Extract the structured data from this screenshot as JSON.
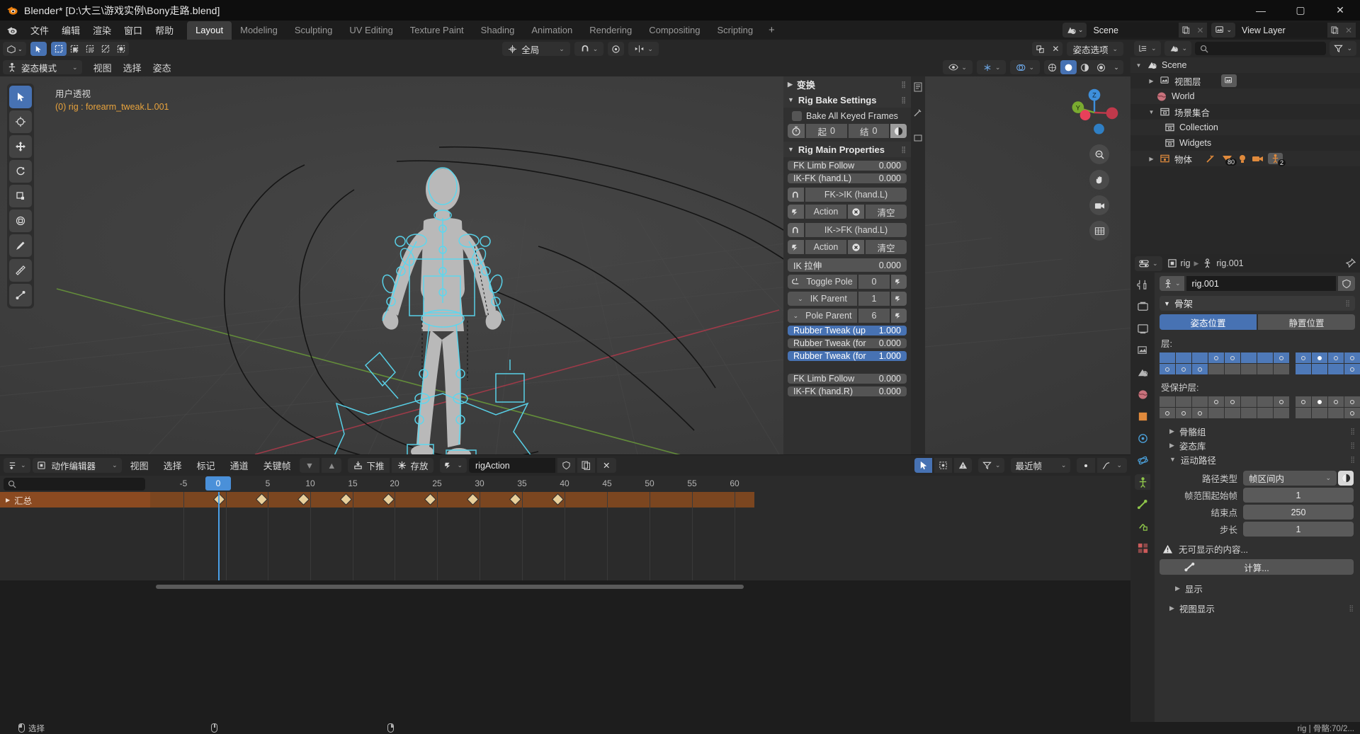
{
  "titlebar": {
    "title": "Blender* [D:\\大三\\游戏实例\\Bony走路.blend]",
    "minimize": "—",
    "maximize": "▢",
    "close": "✕"
  },
  "topbar": {
    "menus": [
      "文件",
      "编辑",
      "渲染",
      "窗口",
      "帮助"
    ],
    "workspaces": [
      "Layout",
      "Modeling",
      "Sculpting",
      "UV Editing",
      "Texture Paint",
      "Shading",
      "Animation",
      "Rendering",
      "Compositing",
      "Scripting"
    ],
    "active_workspace": "Layout",
    "add_workspace": "+",
    "scene_name": "Scene",
    "view_layer_name": "View Layer"
  },
  "viewport_header": {
    "transform_orientation": "全局",
    "select_mode_label": "姿态选项",
    "mode": "姿态模式",
    "menus": [
      "视图",
      "选择",
      "姿态"
    ]
  },
  "viewport": {
    "view_name": "用户透视",
    "active_object": "(0) rig : forearm_tweak.L.001",
    "gizmo_axes": [
      "X",
      "Y",
      "Z"
    ]
  },
  "npanel": {
    "sections": [
      {
        "title": "变换",
        "expanded": false
      },
      {
        "title": "Rig Bake Settings",
        "expanded": true
      },
      {
        "title": "Rig Main Properties",
        "expanded": true
      }
    ],
    "bake": {
      "checkbox_label": "Bake All Keyed Frames",
      "checked": false,
      "start_label": "起",
      "start_value": "0",
      "end_label": "结",
      "end_value": "0"
    },
    "props": [
      {
        "kind": "value",
        "label": "FK Limb Follow",
        "value": "0.000",
        "highlight": false
      },
      {
        "kind": "value",
        "label": "IK-FK (hand.L)",
        "value": "0.000",
        "highlight": false
      },
      {
        "kind": "op",
        "label": "FK->IK (hand.L)"
      },
      {
        "kind": "action",
        "label": "Action",
        "clear": "清空"
      },
      {
        "kind": "op",
        "label": "IK->FK (hand.L)"
      },
      {
        "kind": "action",
        "label": "Action",
        "clear": "清空"
      },
      {
        "kind": "value",
        "label": "IK 拉伸",
        "value": "0.000",
        "highlight": false
      },
      {
        "kind": "stepper",
        "label": "Toggle Pole",
        "value": "0"
      },
      {
        "kind": "dropdown",
        "label": "IK Parent",
        "value": "1"
      },
      {
        "kind": "dropdown",
        "label": "Pole Parent",
        "value": "6"
      },
      {
        "kind": "value",
        "label": "Rubber Tweak (up",
        "value": "1.000",
        "highlight": true
      },
      {
        "kind": "value",
        "label": "Rubber Tweak (for",
        "value": "0.000",
        "highlight": false
      },
      {
        "kind": "value",
        "label": "Rubber Tweak (for",
        "value": "1.000",
        "highlight": true
      },
      {
        "kind": "spacer"
      },
      {
        "kind": "value",
        "label": "FK Limb Follow",
        "value": "0.000",
        "highlight": false
      },
      {
        "kind": "value",
        "label": "IK-FK (hand.R)",
        "value": "0.000",
        "highlight": false
      }
    ]
  },
  "dopesheet": {
    "editor_name": "动作编辑器",
    "menus": [
      "视图",
      "选择",
      "标记",
      "通道",
      "关键帧"
    ],
    "push_down": "下推",
    "stash": "存放",
    "action_name": "rigAction",
    "snap_label": "最近帧",
    "search_placeholder": "",
    "channels": [
      {
        "name": "汇总",
        "expanded": false
      }
    ],
    "ruler_ticks": [
      "-5",
      "0",
      "5",
      "10",
      "15",
      "20",
      "25",
      "30",
      "35",
      "40",
      "45",
      "50",
      "55",
      "60"
    ],
    "current_frame": "0",
    "keyframes": [
      0,
      5,
      10,
      15,
      20,
      25,
      30,
      35,
      40
    ]
  },
  "outliner": {
    "display_mode": "视图层",
    "search_placeholder": "",
    "rows": [
      {
        "indent": 0,
        "tri": "▼",
        "icon": "scene-icon",
        "label": "Scene"
      },
      {
        "indent": 1,
        "tri": "▶",
        "icon": "viewlayer-icon",
        "label": "视图层",
        "extra": "viewlayer-badge"
      },
      {
        "indent": 1,
        "tri": "",
        "icon": "world-icon",
        "label": "World"
      },
      {
        "indent": 1,
        "tri": "▼",
        "icon": "collection-icon",
        "label": "场景集合"
      },
      {
        "indent": 2,
        "tri": "",
        "icon": "collection-icon",
        "label": "Collection"
      },
      {
        "indent": 2,
        "tri": "",
        "icon": "collection-icon",
        "label": "Widgets"
      },
      {
        "indent": 1,
        "tri": "▶",
        "icon": "objects-icon",
        "label": "物体",
        "counts": [
          "80",
          "2"
        ]
      }
    ]
  },
  "properties": {
    "breadcrumb": [
      "rig",
      "rig.001"
    ],
    "id_name": "rig.001",
    "sections": {
      "armature_title": "骨架",
      "pose_position": "姿态位置",
      "rest_position": "静置位置",
      "pose_active": true,
      "layers_label": "层:",
      "protected_layers_label": "受保护层:",
      "bone_groups": "骨骼组",
      "pose_library": "姿态库",
      "motion_paths": "运动路径",
      "display": "显示",
      "viewport_display": "视图显示"
    },
    "motion_paths": {
      "path_type_label": "路径类型",
      "path_type_value": "帧区间内",
      "frame_start_label": "帧范围起始帧",
      "frame_start_value": "1",
      "frame_end_label": "结束点",
      "frame_end_value": "250",
      "step_label": "步长",
      "step_value": "1",
      "warning": "无可显示的内容...",
      "calculate": "计算..."
    },
    "layers_top": [
      [
        true,
        true,
        true,
        true,
        true,
        true,
        true,
        true
      ],
      [
        true,
        true,
        true,
        false,
        false,
        false,
        false,
        false
      ]
    ],
    "layers_top_dots": [
      [
        false,
        false,
        false,
        true,
        true,
        false,
        false,
        true
      ],
      [
        true,
        true,
        true,
        false,
        false,
        false,
        false,
        false
      ]
    ],
    "layers_top2": [
      [
        true,
        true,
        true,
        true,
        true,
        true,
        true,
        true
      ],
      [
        true,
        true,
        true,
        true,
        false,
        false,
        false,
        false
      ]
    ],
    "layers_top2_dots": [
      [
        true,
        "filled",
        true,
        true,
        true,
        true,
        true,
        true
      ],
      [
        false,
        false,
        false,
        true,
        true,
        true,
        true,
        true
      ]
    ],
    "layers_prot": [
      [
        false,
        false,
        false,
        false,
        false,
        false,
        false,
        false
      ],
      [
        false,
        false,
        false,
        false,
        false,
        false,
        false,
        false
      ]
    ],
    "layers_prot_dots": [
      [
        false,
        false,
        false,
        true,
        true,
        false,
        false,
        true
      ],
      [
        true,
        true,
        true,
        false,
        false,
        false,
        false,
        false
      ]
    ],
    "layers_prot2_dots": [
      [
        true,
        "filled",
        true,
        true,
        true,
        true,
        true,
        true
      ],
      [
        false,
        false,
        false,
        true,
        true,
        true,
        true,
        true
      ]
    ]
  },
  "statusbar": {
    "select_label": "选择",
    "info": "rig | 骨骼:70/2...",
    "version": ""
  },
  "colors": {
    "accent_blue": "#4772b3",
    "orange": "#c47832",
    "header_bg": "#272727",
    "panel_bg": "#303030",
    "viewport_bg": "#3b3b3b",
    "keyframe": "#e6c88a"
  }
}
